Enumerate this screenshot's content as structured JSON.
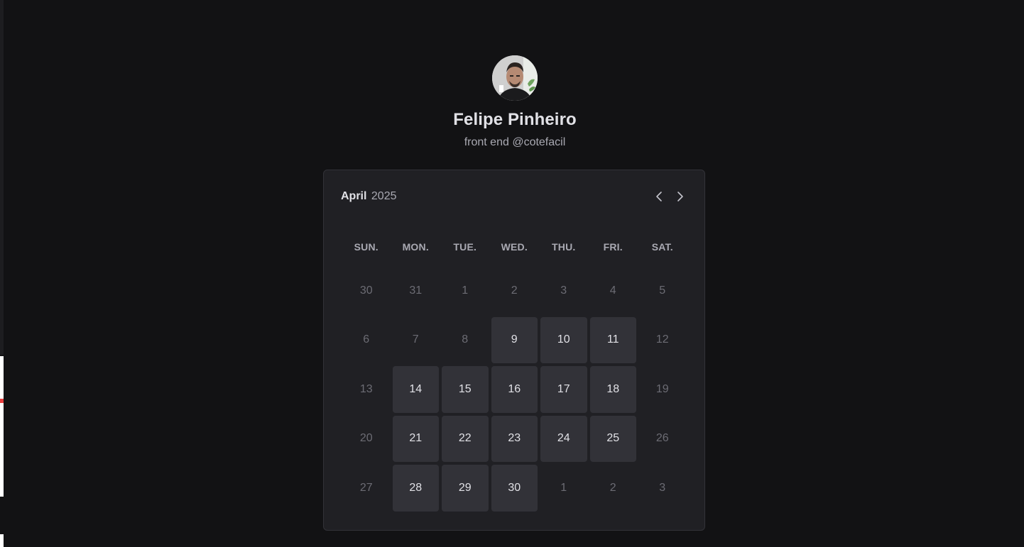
{
  "profile": {
    "name": "Felipe Pinheiro",
    "bio": "front end @cotefacil",
    "avatar_icon": "user-photo"
  },
  "calendar": {
    "month": "April",
    "year": "2025",
    "prev_icon": "chevron-left-icon",
    "next_icon": "chevron-right-icon",
    "weekdays": [
      "SUN.",
      "MON.",
      "TUE.",
      "WED.",
      "THU.",
      "FRI.",
      "SAT."
    ],
    "days": [
      {
        "label": "30",
        "available": false
      },
      {
        "label": "31",
        "available": false
      },
      {
        "label": "1",
        "available": false
      },
      {
        "label": "2",
        "available": false
      },
      {
        "label": "3",
        "available": false
      },
      {
        "label": "4",
        "available": false
      },
      {
        "label": "5",
        "available": false
      },
      {
        "label": "6",
        "available": false
      },
      {
        "label": "7",
        "available": false
      },
      {
        "label": "8",
        "available": false
      },
      {
        "label": "9",
        "available": true
      },
      {
        "label": "10",
        "available": true
      },
      {
        "label": "11",
        "available": true
      },
      {
        "label": "12",
        "available": false
      },
      {
        "label": "13",
        "available": false
      },
      {
        "label": "14",
        "available": true
      },
      {
        "label": "15",
        "available": true
      },
      {
        "label": "16",
        "available": true
      },
      {
        "label": "17",
        "available": true
      },
      {
        "label": "18",
        "available": true
      },
      {
        "label": "19",
        "available": false
      },
      {
        "label": "20",
        "available": false
      },
      {
        "label": "21",
        "available": true
      },
      {
        "label": "22",
        "available": true
      },
      {
        "label": "23",
        "available": true
      },
      {
        "label": "24",
        "available": true
      },
      {
        "label": "25",
        "available": true
      },
      {
        "label": "26",
        "available": false
      },
      {
        "label": "27",
        "available": false
      },
      {
        "label": "28",
        "available": true
      },
      {
        "label": "29",
        "available": true
      },
      {
        "label": "30",
        "available": true
      },
      {
        "label": "1",
        "available": false
      },
      {
        "label": "2",
        "available": false
      },
      {
        "label": "3",
        "available": false
      }
    ]
  },
  "colors": {
    "background": "#121214",
    "card": "#202024",
    "available_day": "#323238",
    "text": "#e1e1e6",
    "muted": "#a9a9b2",
    "disabled": "#6c6c74"
  }
}
